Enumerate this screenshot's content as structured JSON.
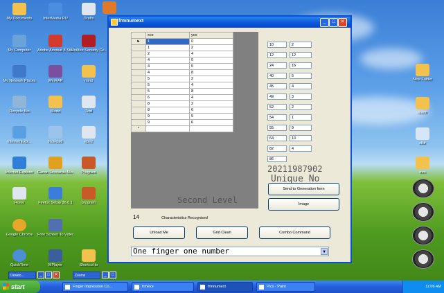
{
  "desktop_icons_left": [
    {
      "label": "My Documents"
    },
    {
      "label": "InterMedia RU"
    },
    {
      "label": "Drafts"
    },
    {
      "label": "My Computer"
    },
    {
      "label": "Adobe Acrobat 8 Standard"
    },
    {
      "label": "McAfee Security Ce..."
    },
    {
      "label": "My Network Places"
    },
    {
      "label": "WinRAR"
    },
    {
      "label": "mind"
    },
    {
      "label": "Recycle Bin"
    },
    {
      "label": "Music"
    },
    {
      "label": "Test"
    },
    {
      "label": "Internet Expl..."
    },
    {
      "label": "Notepad"
    },
    {
      "label": "epe2"
    },
    {
      "label": "Internet Explorer"
    },
    {
      "label": "Canon Leonardo Media Suite"
    },
    {
      "label": "Program"
    },
    {
      "label": "Home"
    },
    {
      "label": "Firefox Setup 36.0.1"
    },
    {
      "label": "program"
    },
    {
      "label": "Google Chrome"
    },
    {
      "label": "Free Screen To Video"
    },
    {
      "label": "QuickTime"
    },
    {
      "label": "MPlayer"
    },
    {
      "label": "Shortcut to"
    }
  ],
  "desktop_icons_right": [
    {
      "label": "New Folder"
    },
    {
      "label": "alarm"
    },
    {
      "label": "zikir"
    },
    {
      "label": "mm"
    }
  ],
  "window": {
    "title": "frmnumext",
    "grid": {
      "columns": [
        "xco",
        "yco"
      ],
      "rows": [
        [
          "1",
          "0"
        ],
        [
          "1",
          "2"
        ],
        [
          "2",
          "4"
        ],
        [
          "4",
          "0"
        ],
        [
          "4",
          "5"
        ],
        [
          "4",
          "8"
        ],
        [
          "5",
          "2"
        ],
        [
          "5",
          "4"
        ],
        [
          "5",
          "8"
        ],
        [
          "6",
          "4"
        ],
        [
          "8",
          "2"
        ],
        [
          "8",
          "6"
        ],
        [
          "9",
          "5"
        ],
        [
          "9",
          "6"
        ]
      ],
      "current_row_marker": "►",
      "new_row_marker": "*"
    },
    "pairs": [
      [
        "10",
        "2"
      ],
      [
        "12",
        "12"
      ],
      [
        "24",
        "16"
      ],
      [
        "40",
        "5"
      ],
      [
        "45",
        "4"
      ],
      [
        "49",
        "3"
      ],
      [
        "52",
        "2"
      ],
      [
        "54",
        "1"
      ],
      [
        "55",
        "9"
      ],
      [
        "64",
        "10"
      ],
      [
        "82",
        "4"
      ],
      [
        "86",
        ""
      ]
    ],
    "big_number": "20211987902",
    "level_text": "Second Level",
    "unique_text": "Unique No",
    "count_value": "14",
    "count_label": "Characteristics Recognised",
    "buttons": {
      "send": "Send to Generation form",
      "image": "Image",
      "unload": "Unload Me",
      "grid_clean": "Grid Clean",
      "combo_command": "Combo Command"
    },
    "combo_value": "One finger one number"
  },
  "taskbar": {
    "start_label": "start",
    "tasks": [
      "Finger Impression Co...",
      "frmexe",
      "frmnumext",
      "Pics - Paint"
    ],
    "active_task": "frmnumext",
    "time": "11:06 AM"
  },
  "minibar": {
    "items": [
      "Deskto...",
      "Zooms"
    ]
  },
  "colors": {
    "titlebar": "#0b55d8",
    "desktop_sky": "#5da0e8",
    "desktop_grass": "#4e9a1f",
    "window_bg": "#ece9d8",
    "grid_bg": "#808080"
  }
}
